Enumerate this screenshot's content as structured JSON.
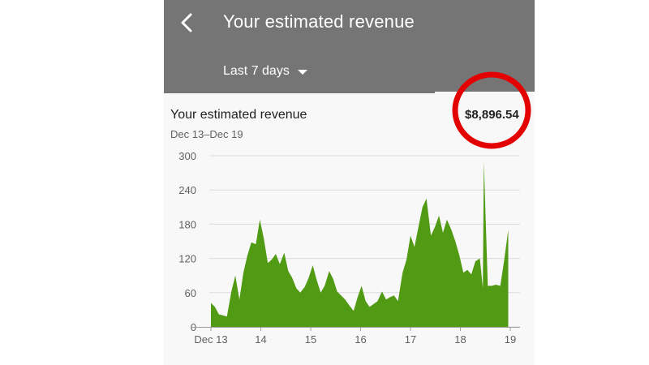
{
  "header": {
    "title": "Your estimated revenue",
    "date_range": "Last 7 days",
    "back_icon": "arrow-back-icon",
    "dropdown_icon": "caret-down-icon",
    "color": "#757575"
  },
  "card": {
    "title": "Your estimated revenue",
    "date_span": "Dec 13–Dec 19",
    "total": "$8,896.54",
    "highlight_color": "#e30000"
  },
  "chart_data": {
    "type": "area",
    "color": "#519a14",
    "ylim": [
      0,
      300
    ],
    "yticks": [
      0,
      60,
      120,
      180,
      240,
      300
    ],
    "xlim": [
      13,
      19
    ],
    "xticks": [
      {
        "x": 13,
        "label": "Dec 13"
      },
      {
        "x": 14,
        "label": "14"
      },
      {
        "x": 15,
        "label": "15"
      },
      {
        "x": 16,
        "label": "16"
      },
      {
        "x": 17,
        "label": "17"
      },
      {
        "x": 18,
        "label": "18"
      },
      {
        "x": 19,
        "label": "19"
      }
    ],
    "grid": true,
    "x": [
      13.0,
      13.08,
      13.16,
      13.24,
      13.32,
      13.41,
      13.49,
      13.57,
      13.65,
      13.73,
      13.81,
      13.9,
      13.98,
      14.06,
      14.14,
      14.22,
      14.3,
      14.38,
      14.47,
      14.55,
      14.63,
      14.71,
      14.79,
      14.88,
      14.96,
      15.04,
      15.12,
      15.2,
      15.28,
      15.37,
      15.45,
      15.53,
      15.61,
      15.69,
      15.77,
      15.86,
      15.94,
      16.02,
      16.1,
      16.18,
      16.26,
      16.34,
      16.43,
      16.51,
      16.59,
      16.67,
      16.75,
      16.84,
      16.92,
      17.0,
      17.08,
      17.16,
      17.24,
      17.32,
      17.41,
      17.49,
      17.57,
      17.65,
      17.73,
      17.82,
      17.9,
      17.98,
      18.06,
      18.14,
      18.22,
      18.3,
      18.39,
      18.45,
      18.47,
      18.55,
      18.63,
      18.71,
      18.8,
      18.88,
      18.96
    ],
    "y": [
      42,
      35,
      22,
      20,
      18,
      62,
      90,
      48,
      95,
      125,
      148,
      145,
      188,
      155,
      112,
      118,
      128,
      110,
      130,
      98,
      86,
      68,
      60,
      70,
      86,
      108,
      82,
      60,
      72,
      98,
      84,
      62,
      55,
      48,
      38,
      28,
      52,
      72,
      45,
      35,
      40,
      45,
      62,
      48,
      52,
      55,
      45,
      95,
      118,
      160,
      140,
      175,
      210,
      225,
      160,
      175,
      195,
      165,
      188,
      170,
      150,
      125,
      95,
      100,
      92,
      115,
      120,
      68,
      290,
      72,
      72,
      74,
      72,
      118,
      170
    ]
  }
}
